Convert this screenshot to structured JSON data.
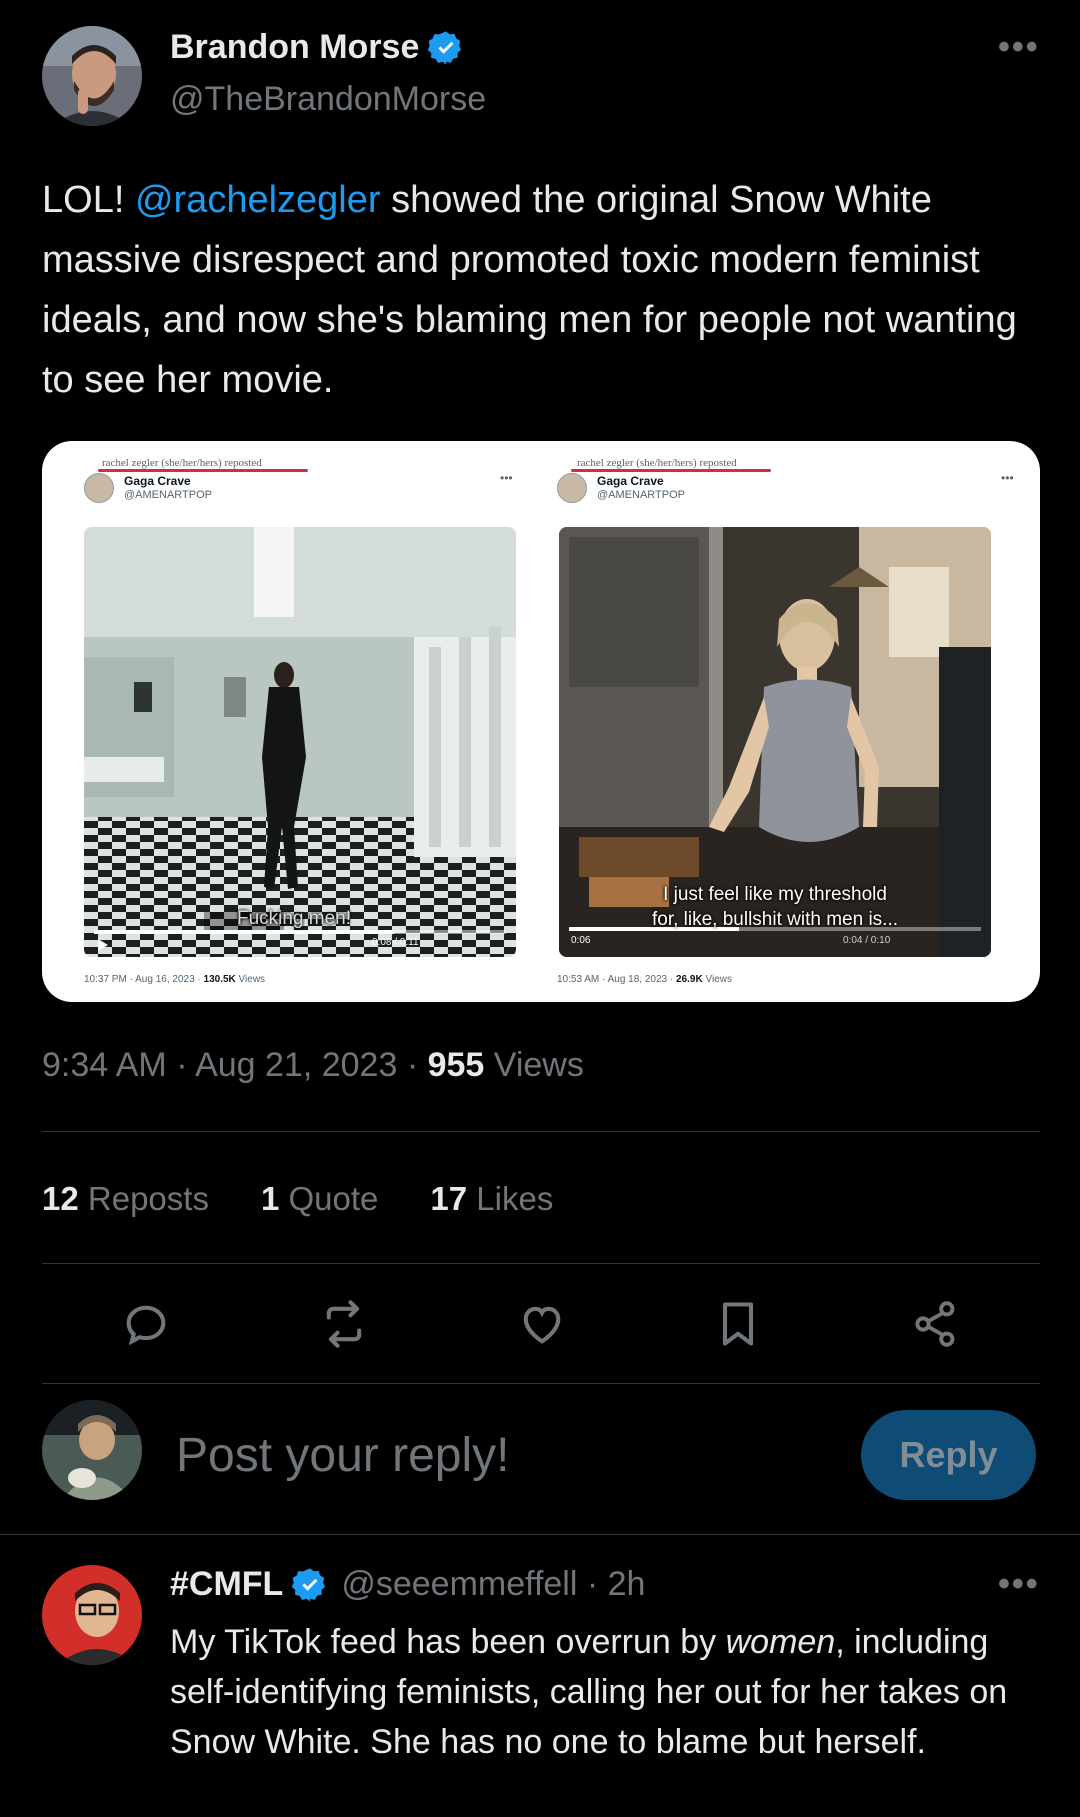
{
  "post": {
    "author_name": "Brandon Morse",
    "author_handle": "@TheBrandonMorse",
    "more_icon": "more-dots-icon",
    "text_before": "LOL! ",
    "mention": "@rachelzegler",
    "text_after": " showed the original Snow White massive disrespect and promoted toxic modern feminist ideals, and now she's blaming men for people not wanting to see her movie.",
    "media": {
      "left": {
        "repost_line": "rachel zegler (she/her/hers) reposted",
        "name": "Gaga Crave",
        "handle": "@AMENARTPOP",
        "subtitle": "Fucking men!",
        "video_time": "0:08 / 0:11",
        "footer_time": "10:37 PM · Aug 16, 2023 · ",
        "footer_views": "130.5K",
        "footer_views_label": " Views"
      },
      "right": {
        "repost_line": "rachel zegler (she/her/hers) reposted",
        "name": "Gaga Crave",
        "handle": "@AMENARTPOP",
        "subtitle_line1": "I just feel like my threshold",
        "subtitle_line2": "for, like, bullshit with men is...",
        "video_time": "0:04 / 0:10",
        "video_badge": "0:06",
        "footer_time": "10:53 AM · Aug 18, 2023 · ",
        "footer_views": "26.9K",
        "footer_views_label": " Views"
      }
    },
    "time": "9:34 AM · Aug 21, 2023 · ",
    "views_count": "955",
    "views_label": " Views",
    "stats": {
      "reposts_count": "12",
      "reposts_label": " Reposts",
      "quotes_count": "1",
      "quotes_label": " Quote",
      "likes_count": "17",
      "likes_label": " Likes"
    },
    "actions": [
      "reply-icon",
      "repost-icon",
      "like-icon",
      "bookmark-icon",
      "share-icon"
    ]
  },
  "composer": {
    "placeholder": "Post your reply!",
    "button_label": "Reply"
  },
  "reply": {
    "author_name": "#CMFL",
    "author_handle": "@seeemmeffell · 2h",
    "text_1": "My TikTok feed has been overrun by ",
    "text_em": "women",
    "text_2": ", including self-identifying feminists, calling her out for her takes on Snow White. She has no one to blame but herself."
  },
  "colors": {
    "background": "#000000",
    "text_primary": "#e7e9ea",
    "text_secondary": "#71767b",
    "accent": "#1d9bf0",
    "reply_button": "#0e4b75",
    "divider": "#2f3336"
  }
}
